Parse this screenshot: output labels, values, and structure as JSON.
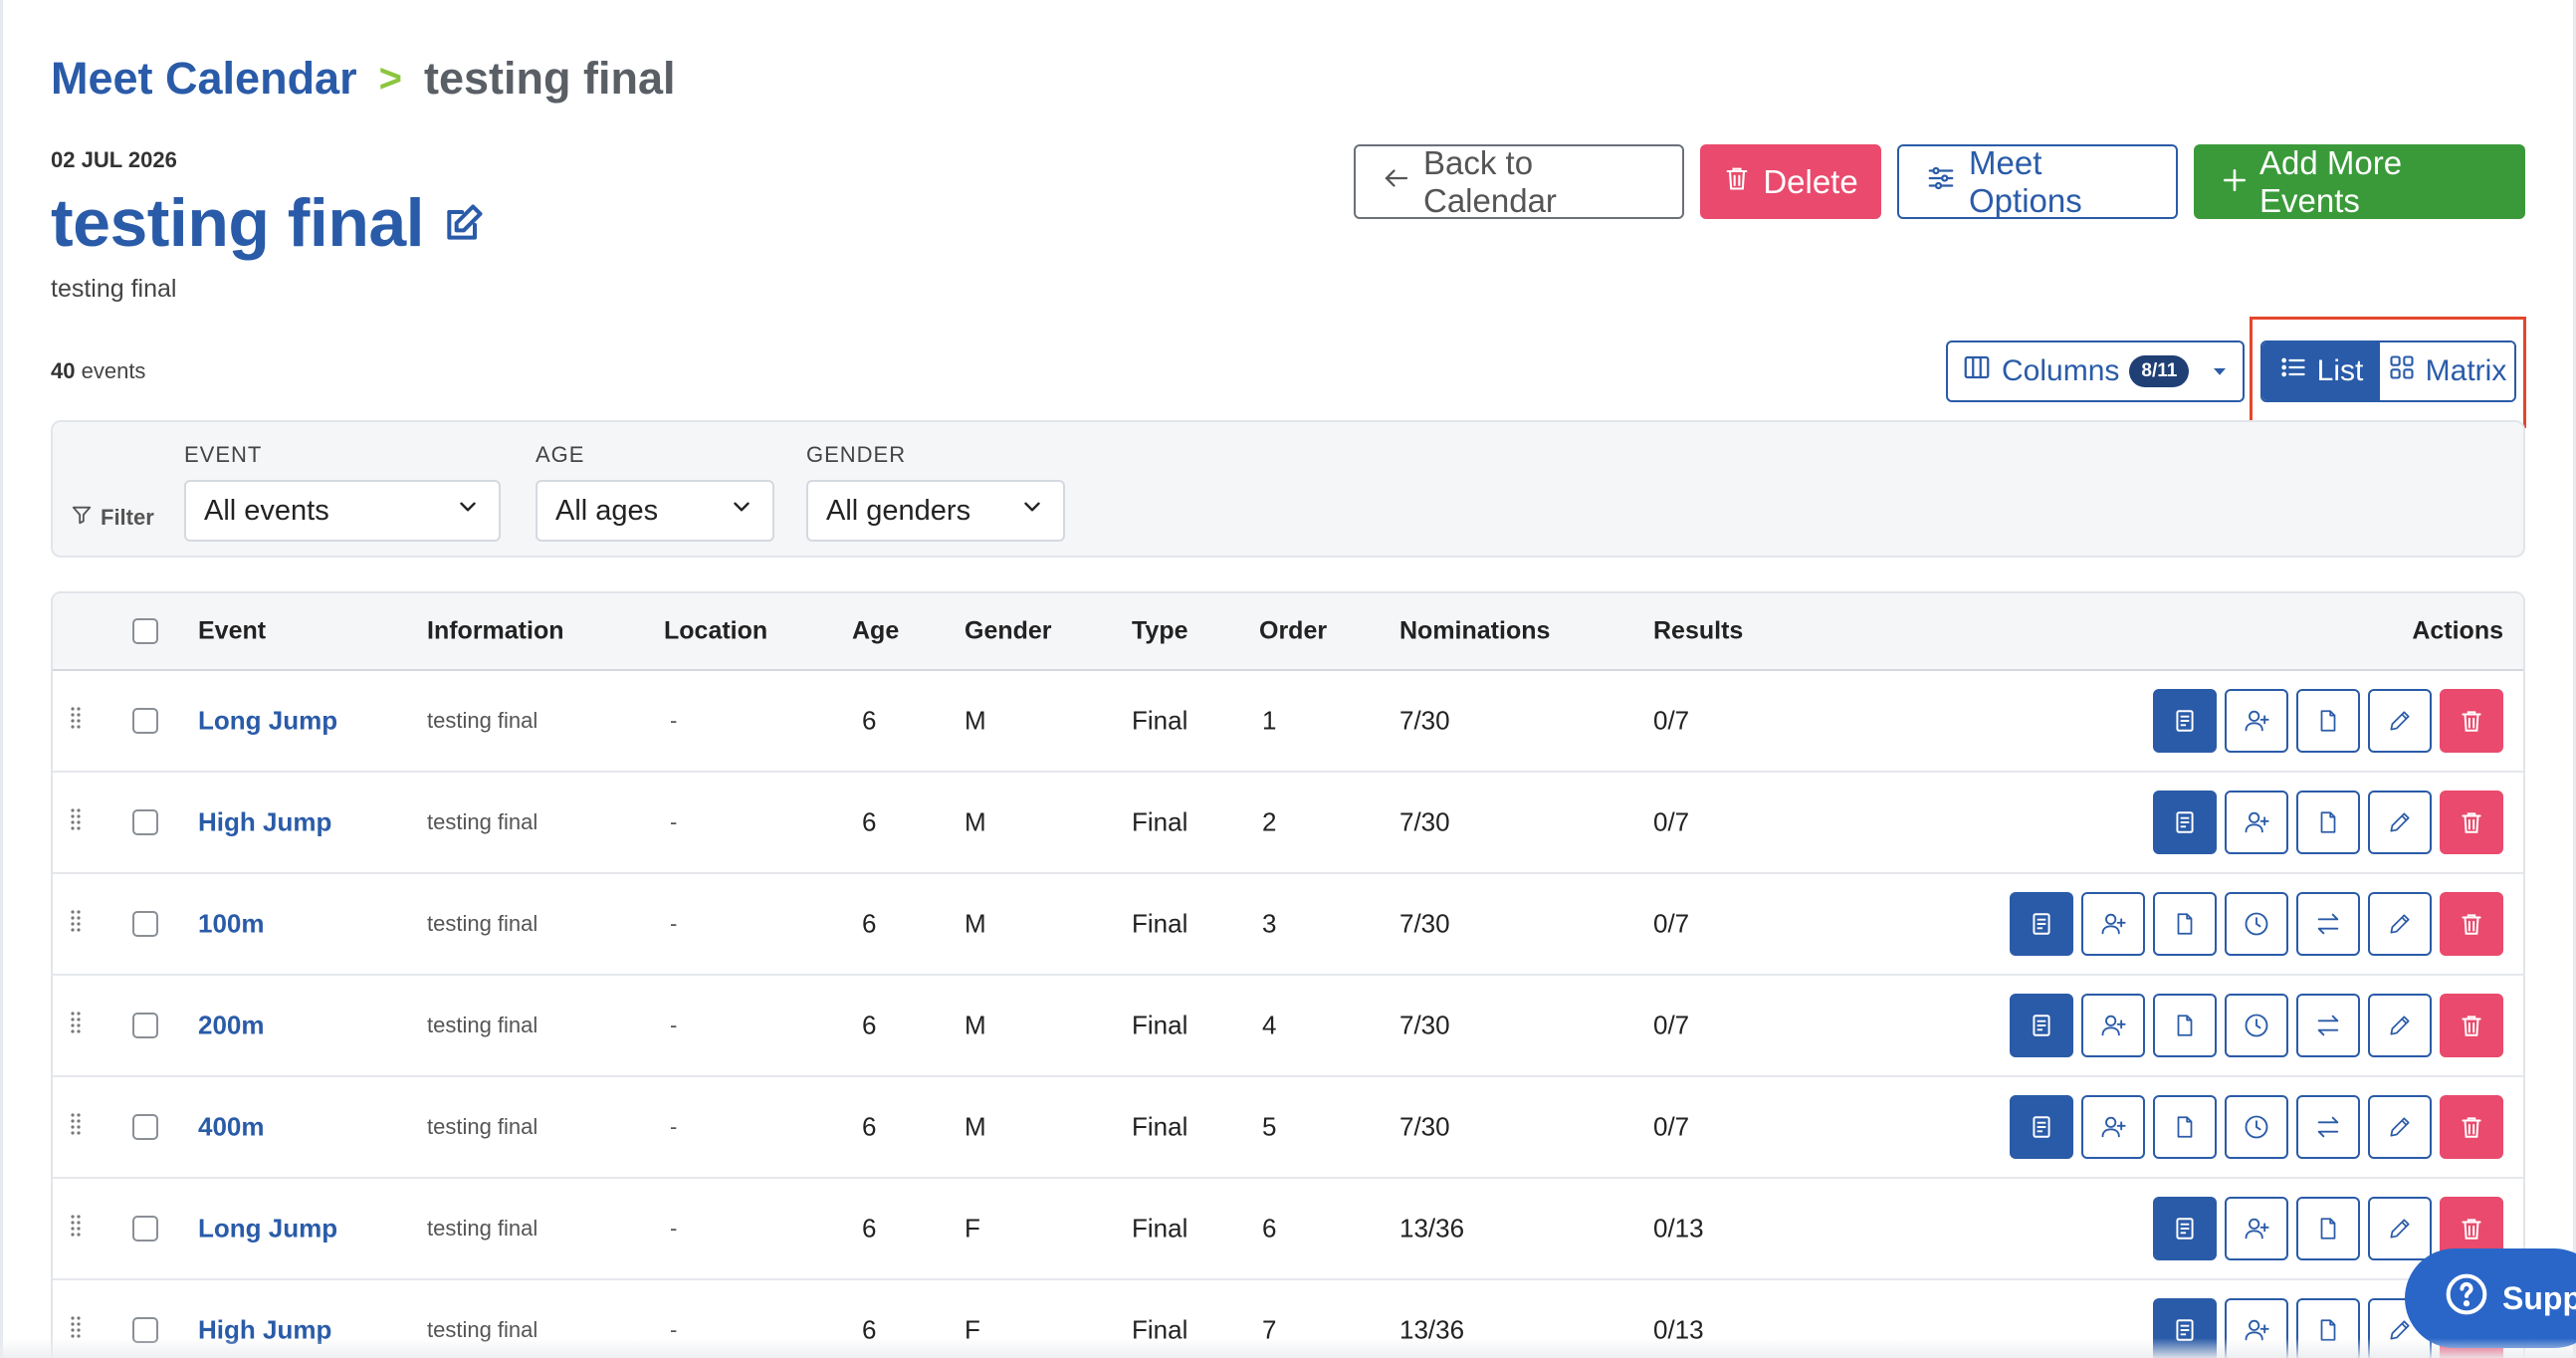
{
  "breadcrumb": {
    "root": "Meet Calendar",
    "separator": ">",
    "current": "testing final"
  },
  "meet": {
    "date": "02 JUL 2026",
    "title": "testing final",
    "description": "testing final"
  },
  "top_actions": {
    "back": "Back to Calendar",
    "delete": "Delete",
    "options": "Meet Options",
    "add": "Add More Events"
  },
  "events_count": {
    "number": "40",
    "label": "events"
  },
  "columns": {
    "label": "Columns",
    "badge": "8/11"
  },
  "view_toggle": {
    "list": "List",
    "matrix": "Matrix",
    "active": "List"
  },
  "filters": {
    "label": "Filter",
    "event": {
      "caption": "EVENT",
      "value": "All events"
    },
    "age": {
      "caption": "AGE",
      "value": "All ages"
    },
    "gender": {
      "caption": "GENDER",
      "value": "All genders"
    }
  },
  "table": {
    "headers": {
      "event": "Event",
      "information": "Information",
      "location": "Location",
      "age": "Age",
      "gender": "Gender",
      "type": "Type",
      "order": "Order",
      "nominations": "Nominations",
      "results": "Results",
      "actions": "Actions"
    },
    "rows": [
      {
        "event": "Long Jump",
        "information": "testing final",
        "location": "-",
        "age": "6",
        "gender": "M",
        "type": "Final",
        "order": "1",
        "nominations": "7/30",
        "results": "0/7",
        "actions": [
          "view",
          "nominate",
          "document",
          "edit",
          "delete"
        ]
      },
      {
        "event": "High Jump",
        "information": "testing final",
        "location": "-",
        "age": "6",
        "gender": "M",
        "type": "Final",
        "order": "2",
        "nominations": "7/30",
        "results": "0/7",
        "actions": [
          "view",
          "nominate",
          "document",
          "edit",
          "delete"
        ]
      },
      {
        "event": "100m",
        "information": "testing final",
        "location": "-",
        "age": "6",
        "gender": "M",
        "type": "Final",
        "order": "3",
        "nominations": "7/30",
        "results": "0/7",
        "actions": [
          "view",
          "nominate",
          "document",
          "timing",
          "swap",
          "edit",
          "delete"
        ]
      },
      {
        "event": "200m",
        "information": "testing final",
        "location": "-",
        "age": "6",
        "gender": "M",
        "type": "Final",
        "order": "4",
        "nominations": "7/30",
        "results": "0/7",
        "actions": [
          "view",
          "nominate",
          "document",
          "timing",
          "swap",
          "edit",
          "delete"
        ]
      },
      {
        "event": "400m",
        "information": "testing final",
        "location": "-",
        "age": "6",
        "gender": "M",
        "type": "Final",
        "order": "5",
        "nominations": "7/30",
        "results": "0/7",
        "actions": [
          "view",
          "nominate",
          "document",
          "timing",
          "swap",
          "edit",
          "delete"
        ]
      },
      {
        "event": "Long Jump",
        "information": "testing final",
        "location": "-",
        "age": "6",
        "gender": "F",
        "type": "Final",
        "order": "6",
        "nominations": "13/36",
        "results": "0/13",
        "actions": [
          "view",
          "nominate",
          "document",
          "edit",
          "delete"
        ]
      },
      {
        "event": "High Jump",
        "information": "testing final",
        "location": "-",
        "age": "6",
        "gender": "F",
        "type": "Final",
        "order": "7",
        "nominations": "13/36",
        "results": "0/13",
        "actions": [
          "view",
          "nominate",
          "document",
          "edit",
          "delete"
        ]
      }
    ]
  },
  "support": {
    "label": "Supp"
  },
  "colors": {
    "primary": "#2a5ba8",
    "danger": "#e94a6d",
    "success": "#3a9a3a",
    "accent_sep": "#8cc63f",
    "highlight": "#e4462b"
  }
}
